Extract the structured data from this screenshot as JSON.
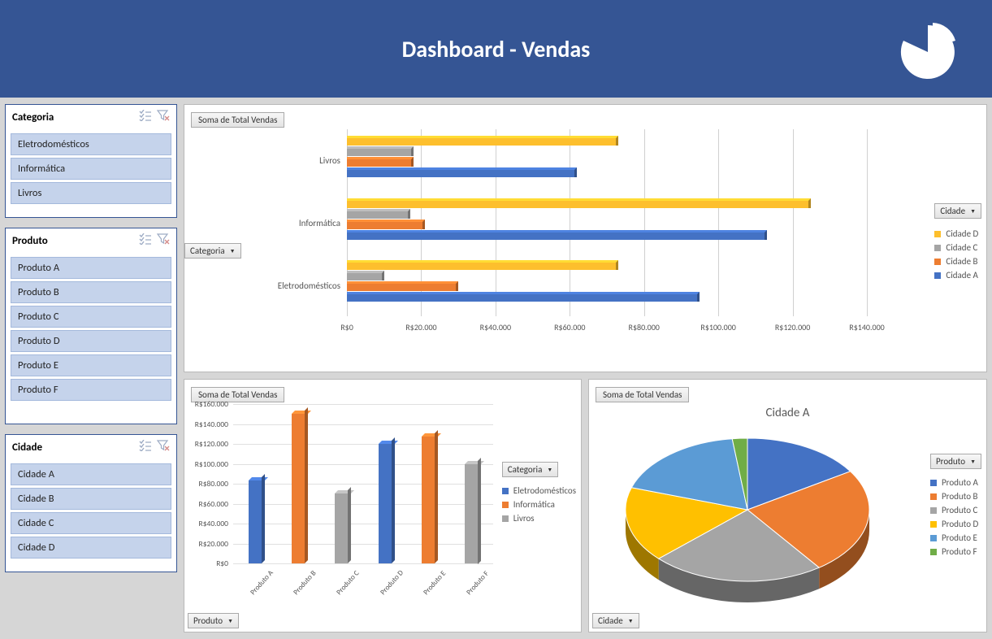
{
  "header": {
    "title": "Dashboard - Vendas"
  },
  "slicers": {
    "categoria": {
      "title": "Categoria",
      "items": [
        "Eletrodomésticos",
        "Informática",
        "Livros"
      ]
    },
    "produto": {
      "title": "Produto",
      "items": [
        "Produto A",
        "Produto B",
        "Produto C",
        "Produto D",
        "Produto E",
        "Produto F"
      ]
    },
    "cidade": {
      "title": "Cidade",
      "items": [
        "Cidade A",
        "Cidade B",
        "Cidade C",
        "Cidade D"
      ]
    }
  },
  "labels": {
    "soma_total": "Soma de Total Vendas",
    "categoria_btn": "Categoria",
    "produto_btn": "Produto",
    "cidade_btn": "Cidade"
  },
  "chart1_legend": {
    "title": "Cidade",
    "items": [
      "Cidade D",
      "Cidade C",
      "Cidade B",
      "Cidade A"
    ]
  },
  "chart2_legend": {
    "title": "Categoria",
    "items": [
      "Eletrodomésticos",
      "Informática",
      "Livros"
    ]
  },
  "pie": {
    "title": "Cidade A",
    "legend_title": "Produto",
    "legend_items": [
      "Produto A",
      "Produto B",
      "Produto C",
      "Produto D",
      "Produto E",
      "Produto F"
    ]
  },
  "chart_data": [
    {
      "type": "bar",
      "orientation": "horizontal",
      "title": "Soma de Total Vendas",
      "xlabel": "",
      "ylabel": "Categoria",
      "xlim": [
        0,
        140000
      ],
      "x_ticks": [
        "R$0",
        "R$20.000",
        "R$40.000",
        "R$60.000",
        "R$80.000",
        "R$100.000",
        "R$120.000",
        "R$140.000"
      ],
      "categories": [
        "Livros",
        "Informática",
        "Eletrodomésticos"
      ],
      "series": [
        {
          "name": "Cidade D",
          "color": "#fdbf2d",
          "values": [
            73000,
            125000,
            73000
          ]
        },
        {
          "name": "Cidade C",
          "color": "#a5a5a5",
          "values": [
            18000,
            17000,
            10000
          ]
        },
        {
          "name": "Cidade B",
          "color": "#ed7d31",
          "values": [
            18000,
            21000,
            30000
          ]
        },
        {
          "name": "Cidade A",
          "color": "#4472c4",
          "values": [
            62000,
            113000,
            95000
          ]
        }
      ]
    },
    {
      "type": "bar",
      "orientation": "vertical",
      "title": "Soma de Total Vendas",
      "ylabel": "",
      "xlabel": "Produto",
      "ylim": [
        0,
        160000
      ],
      "y_ticks": [
        "R$0",
        "R$20.000",
        "R$40.000",
        "R$60.000",
        "R$80.000",
        "R$100.000",
        "R$120.000",
        "R$140.000",
        "R$160.000"
      ],
      "categories": [
        "Produto A",
        "Produto B",
        "Produto C",
        "Produto D",
        "Produto E",
        "Produto F"
      ],
      "series_map": {
        "Produto A": {
          "series": "Eletrodomésticos",
          "color": "#4472c4",
          "value": 83000
        },
        "Produto B": {
          "series": "Informática",
          "color": "#ed7d31",
          "value": 150000
        },
        "Produto C": {
          "series": "Livros",
          "color": "#a5a5a5",
          "value": 70000
        },
        "Produto D": {
          "series": "Eletrodomésticos",
          "color": "#4472c4",
          "value": 120000
        },
        "Produto E": {
          "series": "Informática",
          "color": "#ed7d31",
          "value": 127000
        },
        "Produto F": {
          "series": "Livros",
          "color": "#a5a5a5",
          "value": 100000
        }
      }
    },
    {
      "type": "pie",
      "title": "Cidade A",
      "slices": [
        {
          "name": "Produto A",
          "color": "#4472c4",
          "value": 16
        },
        {
          "name": "Produto B",
          "color": "#ed7d31",
          "value": 24
        },
        {
          "name": "Produto C",
          "color": "#a5a5a5",
          "value": 23
        },
        {
          "name": "Produto D",
          "color": "#ffc000",
          "value": 17
        },
        {
          "name": "Produto E",
          "color": "#5b9bd5",
          "value": 18
        },
        {
          "name": "Produto F",
          "color": "#70ad47",
          "value": 2
        }
      ]
    }
  ]
}
